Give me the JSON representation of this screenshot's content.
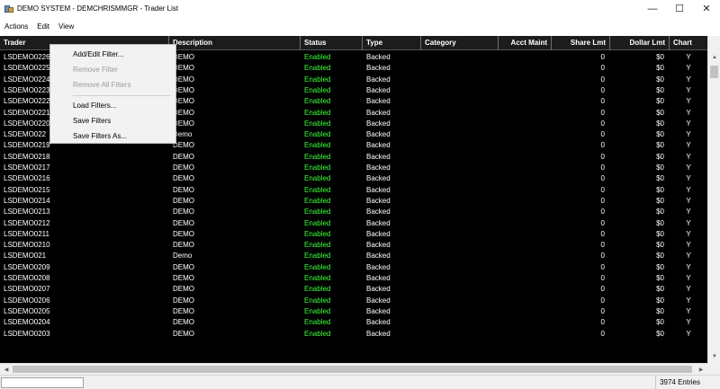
{
  "window": {
    "title": "DEMO SYSTEM - DEMCHRISMMGR - Trader List",
    "minimize_glyph": "—",
    "maximize_glyph": "☐",
    "close_glyph": "✕"
  },
  "menu": [
    "Actions",
    "Edit",
    "View"
  ],
  "columns": [
    "Trader",
    "Description",
    "Status",
    "Type",
    "Category",
    "Acct Maint",
    "Share Lmt",
    "Dollar Lmt",
    "Chart"
  ],
  "rows": [
    [
      "LSDEMO0226",
      "DEMO",
      "Enabled",
      "Backed",
      "",
      "",
      "0",
      "$0",
      "Y"
    ],
    [
      "LSDEMO0225",
      "DEMO",
      "Enabled",
      "Backed",
      "",
      "",
      "0",
      "$0",
      "Y"
    ],
    [
      "LSDEMO0224",
      "DEMO",
      "Enabled",
      "Backed",
      "",
      "",
      "0",
      "$0",
      "Y"
    ],
    [
      "LSDEMO0223",
      "DEMO",
      "Enabled",
      "Backed",
      "",
      "",
      "0",
      "$0",
      "Y"
    ],
    [
      "LSDEMO0222",
      "DEMO",
      "Enabled",
      "Backed",
      "",
      "",
      "0",
      "$0",
      "Y"
    ],
    [
      "LSDEMO0221",
      "DEMO",
      "Enabled",
      "Backed",
      "",
      "",
      "0",
      "$0",
      "Y"
    ],
    [
      "LSDEMO0220",
      "DEMO",
      "Enabled",
      "Backed",
      "",
      "",
      "0",
      "$0",
      "Y"
    ],
    [
      "LSDEMO022",
      "Demo",
      "Enabled",
      "Backed",
      "",
      "",
      "0",
      "$0",
      "Y"
    ],
    [
      "LSDEMO0219",
      "DEMO",
      "Enabled",
      "Backed",
      "",
      "",
      "0",
      "$0",
      "Y"
    ],
    [
      "LSDEMO0218",
      "DEMO",
      "Enabled",
      "Backed",
      "",
      "",
      "0",
      "$0",
      "Y"
    ],
    [
      "LSDEMO0217",
      "DEMO",
      "Enabled",
      "Backed",
      "",
      "",
      "0",
      "$0",
      "Y"
    ],
    [
      "LSDEMO0216",
      "DEMO",
      "Enabled",
      "Backed",
      "",
      "",
      "0",
      "$0",
      "Y"
    ],
    [
      "LSDEMO0215",
      "DEMO",
      "Enabled",
      "Backed",
      "",
      "",
      "0",
      "$0",
      "Y"
    ],
    [
      "LSDEMO0214",
      "DEMO",
      "Enabled",
      "Backed",
      "",
      "",
      "0",
      "$0",
      "Y"
    ],
    [
      "LSDEMO0213",
      "DEMO",
      "Enabled",
      "Backed",
      "",
      "",
      "0",
      "$0",
      "Y"
    ],
    [
      "LSDEMO0212",
      "DEMO",
      "Enabled",
      "Backed",
      "",
      "",
      "0",
      "$0",
      "Y"
    ],
    [
      "LSDEMO0211",
      "DEMO",
      "Enabled",
      "Backed",
      "",
      "",
      "0",
      "$0",
      "Y"
    ],
    [
      "LSDEMO0210",
      "DEMO",
      "Enabled",
      "Backed",
      "",
      "",
      "0",
      "$0",
      "Y"
    ],
    [
      "LSDEMO021",
      "Demo",
      "Enabled",
      "Backed",
      "",
      "",
      "0",
      "$0",
      "Y"
    ],
    [
      "LSDEMO0209",
      "DEMO",
      "Enabled",
      "Backed",
      "",
      "",
      "0",
      "$0",
      "Y"
    ],
    [
      "LSDEMO0208",
      "DEMO",
      "Enabled",
      "Backed",
      "",
      "",
      "0",
      "$0",
      "Y"
    ],
    [
      "LSDEMO0207",
      "DEMO",
      "Enabled",
      "Backed",
      "",
      "",
      "0",
      "$0",
      "Y"
    ],
    [
      "LSDEMO0206",
      "DEMO",
      "Enabled",
      "Backed",
      "",
      "",
      "0",
      "$0",
      "Y"
    ],
    [
      "LSDEMO0205",
      "DEMO",
      "Enabled",
      "Backed",
      "",
      "",
      "0",
      "$0",
      "Y"
    ],
    [
      "LSDEMO0204",
      "DEMO",
      "Enabled",
      "Backed",
      "",
      "",
      "0",
      "$0",
      "Y"
    ],
    [
      "LSDEMO0203",
      "DEMO",
      "Enabled",
      "Backed",
      "",
      "",
      "0",
      "$0",
      "Y"
    ]
  ],
  "filter_menu": {
    "items": [
      {
        "label": "Add/Edit Filter...",
        "enabled": true
      },
      {
        "label": "Remove Filter",
        "enabled": false
      },
      {
        "label": "Remove All Filters",
        "enabled": false
      },
      {
        "label": "Load Filters...",
        "enabled": true
      },
      {
        "label": "Save Filters",
        "enabled": true
      },
      {
        "label": "Save Filters As...",
        "enabled": true
      }
    ]
  },
  "status": {
    "entries": "3974 Entries"
  },
  "colors": {
    "grid_bg": "#000000",
    "status_enabled": "#3cff3c",
    "header_bg": "#1c1c1c"
  }
}
